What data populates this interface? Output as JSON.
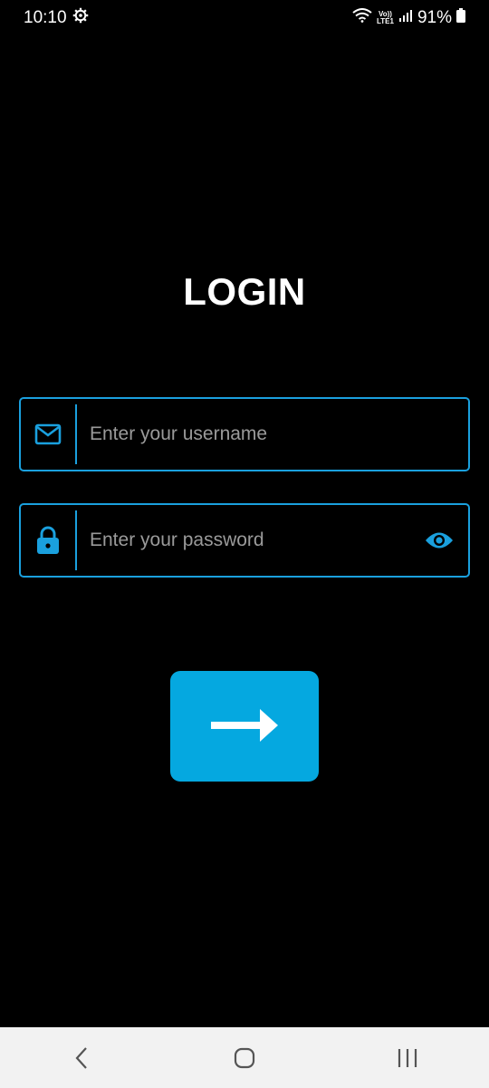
{
  "status_bar": {
    "time": "10:10",
    "battery": "91%",
    "network_label_top": "Vo))",
    "network_label_bottom": "LTE1",
    "icons": [
      "settings-gear-icon",
      "wifi-icon",
      "signal-icon",
      "battery-icon"
    ]
  },
  "page": {
    "title": "LOGIN"
  },
  "form": {
    "username": {
      "placeholder": "Enter your username",
      "value": "",
      "icon": "mail-icon"
    },
    "password": {
      "placeholder": "Enter your password",
      "value": "",
      "icon": "lock-icon",
      "toggle_icon": "eye-icon"
    },
    "submit_icon": "arrow-right-icon"
  },
  "nav_bar": {
    "icons": [
      "back-icon",
      "home-icon",
      "recents-icon"
    ]
  },
  "colors": {
    "background": "#000000",
    "accent": "#1aa0de",
    "button": "#05a8e0",
    "placeholder": "#9a9a9a",
    "nav_background": "#f2f2f2"
  }
}
